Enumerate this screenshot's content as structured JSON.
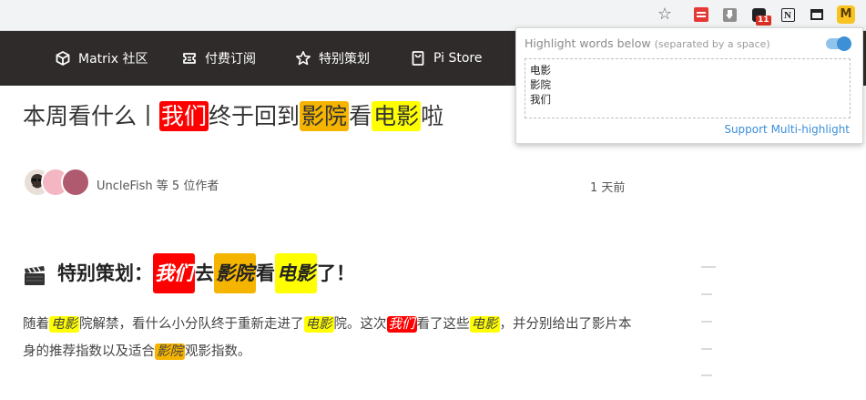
{
  "browser": {
    "extension_badge": "11",
    "icons": [
      "star-icon",
      "red-list-extension-icon",
      "download-extension-icon",
      "badge-extension-icon",
      "notion-extension-icon",
      "window-extension-icon",
      "highlight-extension-icon"
    ],
    "highlight_extension_letter": "M"
  },
  "nav": {
    "items": [
      {
        "label": "Matrix 社区",
        "icon": "cube-icon"
      },
      {
        "label": "付费订阅",
        "icon": "ticket-icon"
      },
      {
        "label": "特别策划",
        "icon": "star-outline-icon"
      },
      {
        "label": "Pi Store",
        "icon": "store-bag-icon"
      }
    ]
  },
  "article": {
    "title_parts": [
      "本周看什么丨",
      "我们",
      "终于回到",
      "影院",
      "看",
      "电影",
      "啦"
    ],
    "author_text": "UncleFish 等 5 位作者",
    "time": "1 天前",
    "section_parts": [
      "特别策划：",
      "我们",
      "去",
      "影院",
      "看",
      "电影",
      "了！"
    ],
    "para_parts": [
      "随着",
      "电影",
      "院解禁，看什么小分队终于重新走进了",
      "电影",
      "院。这次",
      "我们",
      "看了这些",
      "电影",
      "，并分别给出了影片本身的推荐指数以及适合",
      "影院",
      "观影指数。"
    ]
  },
  "popup": {
    "label": "Highlight words below",
    "label_sub": "(separated by a space)",
    "toggle_on": true,
    "words": [
      "电影",
      "影院",
      "我们"
    ],
    "link": "Support Multi-highlight"
  },
  "colors": {
    "red": "#ff0000",
    "orange": "#f5b400",
    "yellow": "#ffff00",
    "nav_bg": "#2f2b2a"
  }
}
